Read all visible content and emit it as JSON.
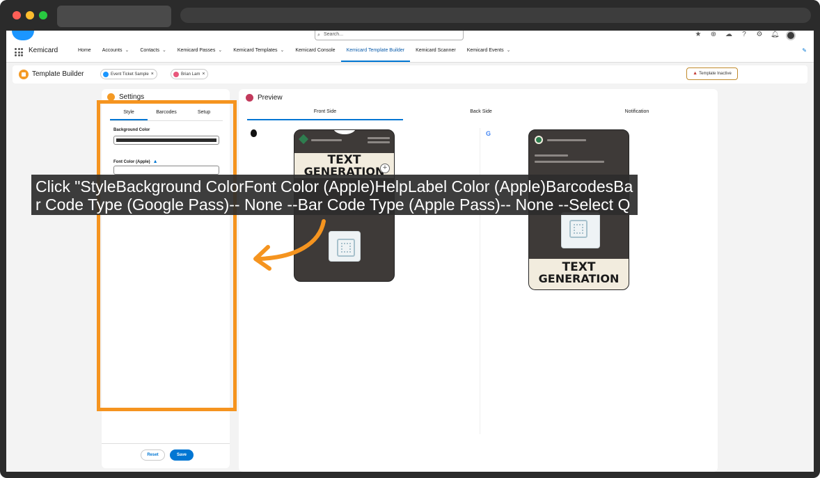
{
  "browser": {
    "window": "mac-browser"
  },
  "header": {
    "search_placeholder": "Search...",
    "app_name": "Kemicard",
    "nav": [
      {
        "label": "Home",
        "dropdown": false
      },
      {
        "label": "Accounts",
        "dropdown": true
      },
      {
        "label": "Contacts",
        "dropdown": true
      },
      {
        "label": "Kemicard Passes",
        "dropdown": true
      },
      {
        "label": "Kemicard Templates",
        "dropdown": true
      },
      {
        "label": "Kemicard Console",
        "dropdown": false
      },
      {
        "label": "Kemicard Template Builder",
        "dropdown": false,
        "active": true
      },
      {
        "label": "Kemicard Scanner",
        "dropdown": false
      },
      {
        "label": "Kemicard Events",
        "dropdown": true
      }
    ],
    "icons": [
      "star-icon",
      "plus-icon",
      "trailhead-icon",
      "help-icon",
      "gear-icon",
      "bell-icon",
      "avatar"
    ]
  },
  "builder": {
    "title": "Template Builder",
    "pills": [
      {
        "label": "Event Ticket Sample",
        "color": "#1b96ff"
      },
      {
        "label": "Brian Lam",
        "color": "#e8577b"
      }
    ],
    "status_badge": "Template Inactive"
  },
  "settings": {
    "title": "Settings",
    "tabs": [
      "Style",
      "Barcodes",
      "Setup"
    ],
    "active_tab": "Style",
    "fields": {
      "background_color_label": "Background Color",
      "font_color_label": "Font Color (Apple)"
    },
    "reset_label": "Reset",
    "save_label": "Save"
  },
  "preview": {
    "title": "Preview",
    "tabs": [
      "Front Side",
      "Back Side",
      "Notification"
    ],
    "active_tab": "Front Side",
    "pass_text_line1": "TEXT",
    "pass_text_line2": "GENERATION"
  },
  "overlay": {
    "caption": "Click \"StyleBackground ColorFont Color (Apple)HelpLabel Color (Apple)BarcodesBar Code Type (Google Pass)-- None --Bar Code Type (Apple Pass)-- None --Select QR",
    "highlight_color": "#f5941f"
  },
  "colors": {
    "accent": "#0176d3",
    "pass_background": "#3e3a38",
    "pass_banner": "#f2ecde"
  }
}
